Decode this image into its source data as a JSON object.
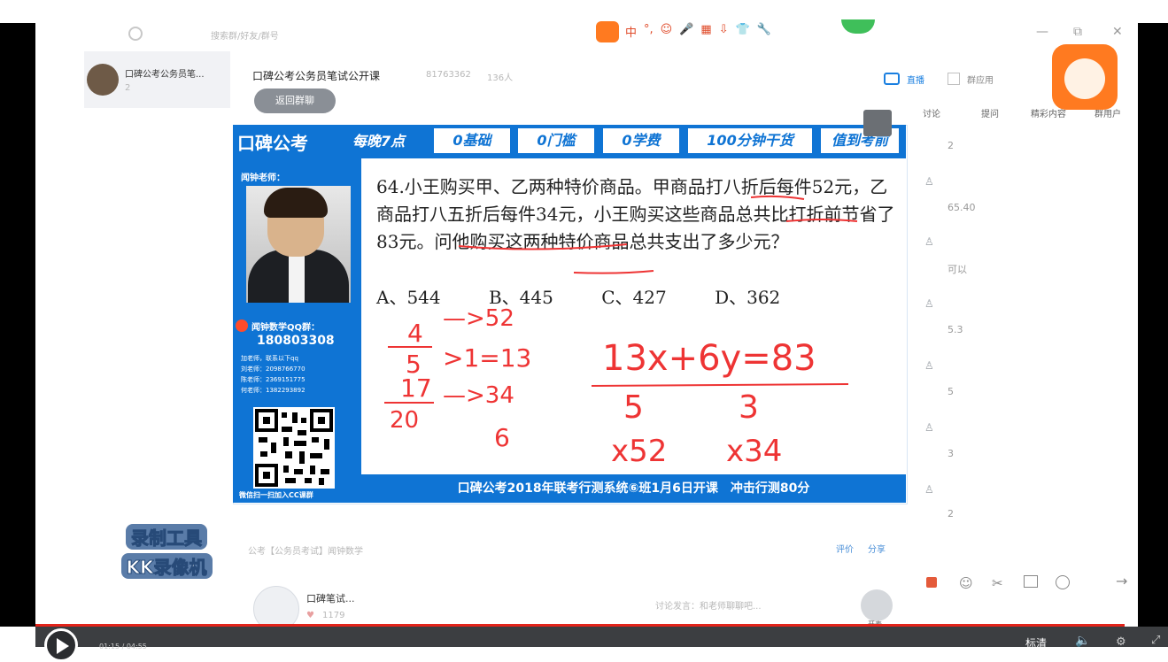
{
  "header": {
    "search_text": "搜索群/好友/群号",
    "toolbar_icons": [
      "中",
      "°,",
      "☺",
      "🎤",
      "▦",
      "⇩",
      "👕",
      "🔧"
    ],
    "window_minimize": "—",
    "window_restore": "⧉",
    "window_close": "✕"
  },
  "sidebar": {
    "selected_item_label": "口碑公考公务员笔...",
    "selected_item_count": "2"
  },
  "group": {
    "title": "口碑公考公务员笔试公开课",
    "id": "81763362",
    "members": "136人",
    "back_button": "返回群聊"
  },
  "slide": {
    "brand": "口碑公考",
    "header_tags": [
      "每晚7点",
      "0基础",
      "0门槛",
      "0学费",
      "100分钟干货",
      "值到考前"
    ],
    "teacher_label": "闻钟老师：",
    "qq_group_label": "闻钟数学QQ群：",
    "qq_group_number": "180803308",
    "contact_lines": [
      "加老师，联系以下qq",
      "刘老师：2098766770",
      "陈老师：2369151775",
      "何老师：1382293892"
    ],
    "qr_caption": "微信扫一扫加入CC课群",
    "problem_text": "64.小王购买甲、乙两种特价商品。甲商品打八折后每件52元，乙商品打八五折后每件34元，小王购买这些商品总共比打折前节省了83元。问他购买这两种特价商品总共支出了多少元？",
    "options": [
      "A、544",
      "B、445",
      "C、427",
      "D、362"
    ],
    "footer_text": "口碑公考2018年联考行测系统⑥班1月6日开课　冲击行测80分",
    "ink": {
      "f1_num": "4",
      "f1_den": "5",
      "f1_arrow": "—>52",
      "f1_eq": ">1=13",
      "f2_num": "17",
      "f2_den": "20",
      "f2_arrow": "—>34",
      "f2_six": "6",
      "equation": "13x+6y=83",
      "x_val": "5",
      "y_val": "3",
      "x_mult": "x52",
      "y_mult": "x34"
    }
  },
  "right_panel": {
    "tabs": [
      "直播",
      "群应用"
    ],
    "subtabs": [
      "讨论",
      "提问",
      "精彩内容",
      "群用户"
    ],
    "messages": [
      {
        "num": "2"
      },
      {
        "num": "65.40"
      },
      {
        "num": "可以"
      },
      {
        "num": "5.3"
      },
      {
        "num": "5"
      },
      {
        "num": "3"
      },
      {
        "num": "2"
      }
    ],
    "bottom_icons": [
      "gift-icon",
      "emoji-icon",
      "scissors-icon",
      "image-icon",
      "clock-icon",
      "send-arrow-icon"
    ]
  },
  "below_slide": {
    "breadcrumb": "公考【公务员考试】闻钟数学",
    "actions": [
      "评价",
      "分享"
    ],
    "channel_name": "口碑笔试...",
    "channel_likes": "1179",
    "chat_placeholder": "讨论发言：和老师聊聊吧...",
    "mic_label": "开麦"
  },
  "watermark": {
    "line1": "录制工具",
    "line2": "KK录像机"
  },
  "player": {
    "time": "01:15 / 04:55",
    "quality": "标清",
    "volume_icon": "volume-icon",
    "settings_icon": "settings-icon",
    "fullscreen_icon": "fullscreen-icon",
    "progress_fraction": 0.955
  },
  "colors": {
    "slide_blue": "#0f74d4",
    "ink_red": "#ee3434",
    "progress_red": "#e2231a",
    "orange_logo": "#ff7a20"
  }
}
